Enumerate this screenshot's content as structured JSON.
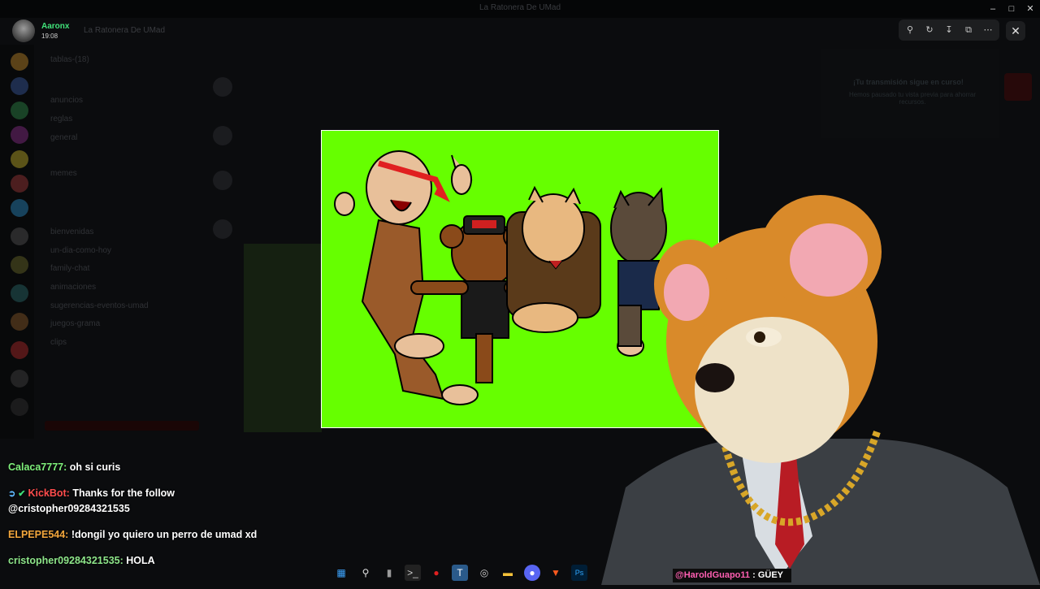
{
  "window": {
    "title": "La Ratonera De UMad"
  },
  "user": {
    "name": "Aaronx",
    "status": "19:08"
  },
  "server": {
    "name": "La Ratonera De UMad"
  },
  "channels": [
    "tablas-(18)",
    "anuncios",
    "reglas",
    "general",
    "memes",
    "bienvenidas",
    "un-dia-como-hoy",
    "family-chat",
    "animaciones",
    "sugerencias-eventos-umad",
    "juegos-grama",
    "clips"
  ],
  "right_panel": {
    "title": "¡Tu transmisión sigue en curso!",
    "body": "Hemos pausado tu vista previa para ahorrar recursos."
  },
  "chat": {
    "messages": [
      {
        "user": "Calaca7777:",
        "text": "oh si curis"
      },
      {
        "user": "KickBot:",
        "text": "Thanks for the follow",
        "text2": "@cristopher09284321535"
      },
      {
        "user": "ELPEPE544:",
        "text": "!dongil yo quiero un perro de umad xd"
      },
      {
        "user": "cristopher09284321535:",
        "text": "HOLA"
      }
    ]
  },
  "overlay": {
    "handle": "@HaroldGuapo11",
    "separator": " : ",
    "text": "GÜEY"
  },
  "colors": {
    "viewer_bg": "#66ff00",
    "chat_user_green": "#7ff07b",
    "chat_user_red": "#ff4d4d",
    "chat_user_orange": "#f2a63c",
    "handle_pink": "#ff5fb2"
  },
  "taskbar_icons": [
    "windows-icon",
    "search-icon",
    "file-icon",
    "terminal-icon",
    "record-icon",
    "app-icon",
    "chrome-icon",
    "folder-icon",
    "discord-icon",
    "brave-icon",
    "photoshop-icon"
  ]
}
